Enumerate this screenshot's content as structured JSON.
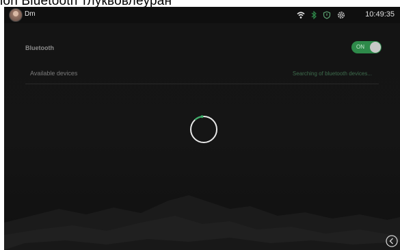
{
  "caption": "ion Bluetooth тлуквовлеуран",
  "status_bar": {
    "username": "Dm",
    "time": "10:49:35",
    "icons": [
      "wifi-icon",
      "bluetooth-icon",
      "shield-icon",
      "settings-icon"
    ]
  },
  "bluetooth": {
    "label": "Bluetooth",
    "toggle_state": "ON"
  },
  "devices": {
    "label": "Available devices",
    "status": "Searching of bluetooth devices..."
  },
  "colors": {
    "accent": "#2e8a4a",
    "background": "#141414"
  }
}
